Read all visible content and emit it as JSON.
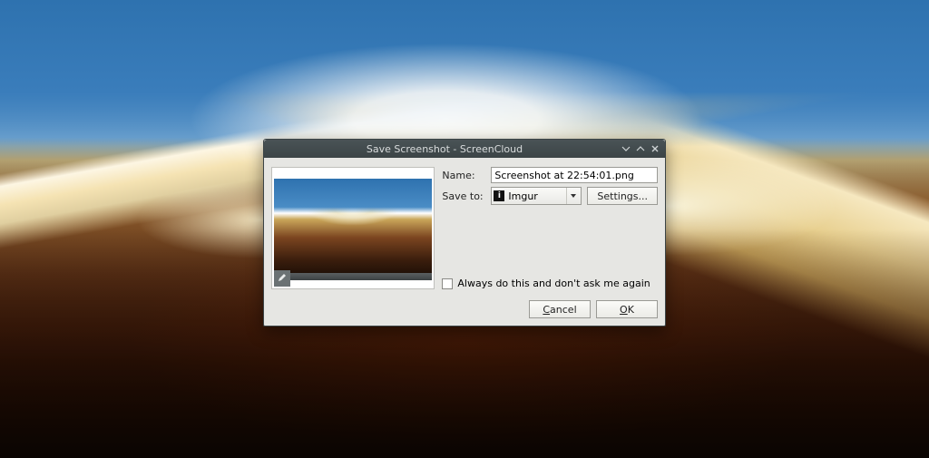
{
  "dialog": {
    "title": "Save Screenshot - ScreenCloud",
    "name_label": "Name:",
    "name_value": "Screenshot at 22:54:01.png",
    "save_to_label": "Save to:",
    "save_to_selected": "Imgur",
    "settings_button": "Settings...",
    "always_checkbox": "Always do this and don't ask me again",
    "always_checked": false,
    "cancel_button": "Cancel",
    "ok_button": "OK",
    "cancel_underline": "C",
    "cancel_rest": "ancel",
    "ok_underline": "O",
    "ok_rest": "K"
  }
}
